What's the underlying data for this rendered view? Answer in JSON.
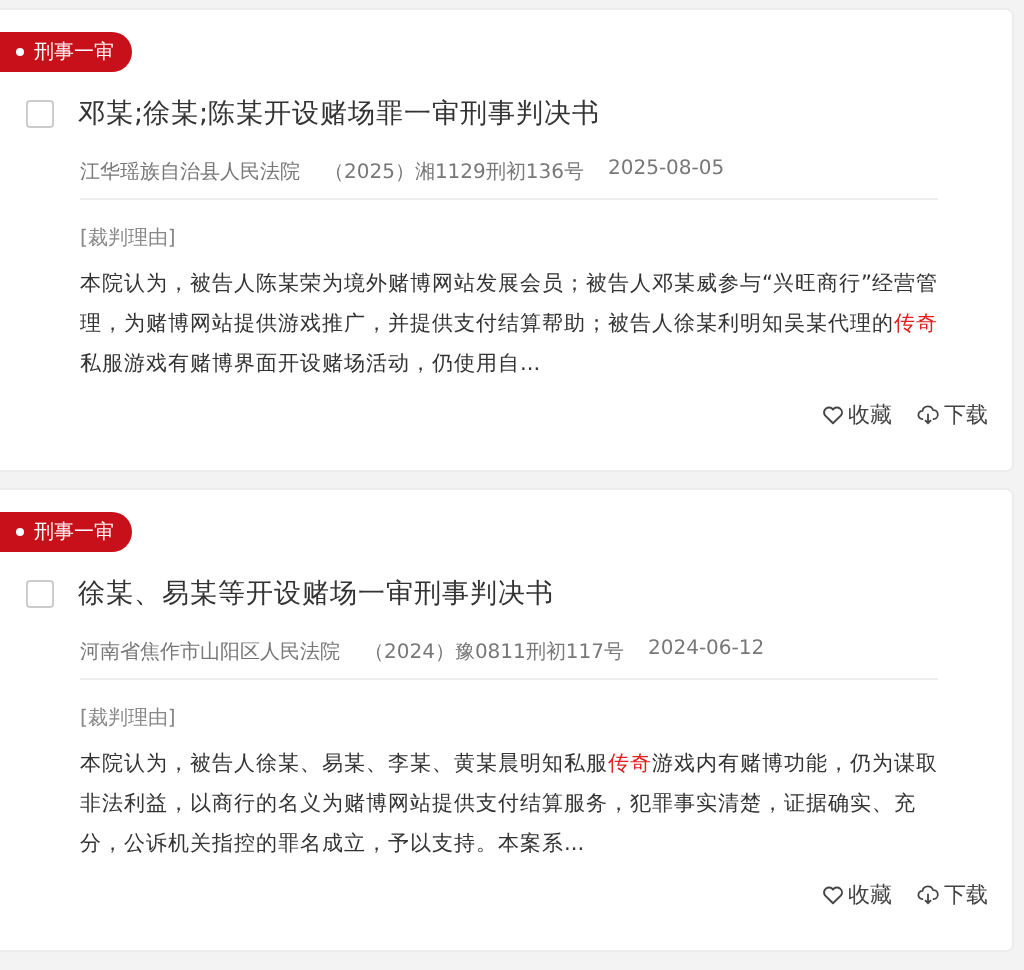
{
  "results": [
    {
      "tag": "刑事一审",
      "checked": false,
      "title": "邓某;徐某;陈某开设赌场罪一审刑事判决书",
      "court": "江华瑶族自治县人民法院",
      "case_number": "（2025）湘1129刑初136号",
      "date": "2025-08-05",
      "section_label": "[裁判理由]",
      "excerpt": [
        {
          "text": "本院认为，被告人陈某荣为境外赌博网站发展会员；被告人邓某威参与“兴旺商行”经营管理，为赌博网站提供游戏推广，并提供支付结算帮助；被告人徐某利明知吴某代理的",
          "highlight": false
        },
        {
          "text": "传奇",
          "highlight": true
        },
        {
          "text": "私服游戏有赌博界面开设赌场活动，仍使用自...",
          "highlight": false
        }
      ],
      "actions": [
        {
          "kind": "favorite",
          "label": "收藏"
        },
        {
          "kind": "download",
          "label": "下载"
        }
      ]
    },
    {
      "tag": "刑事一审",
      "checked": false,
      "title": "徐某、易某等开设赌场一审刑事判决书",
      "court": "河南省焦作市山阳区人民法院",
      "case_number": "（2024）豫0811刑初117号",
      "date": "2024-06-12",
      "section_label": "[裁判理由]",
      "excerpt": [
        {
          "text": "本院认为，被告人徐某、易某、李某、黄某晨明知私服",
          "highlight": false
        },
        {
          "text": "传奇",
          "highlight": true
        },
        {
          "text": "游戏内有赌博功能，仍为谋取非法利益，以商行的名义为赌博网站提供支付结算服务，犯罪事实清楚，证据确实、充分，公诉机关指控的罪名成立，予以支持。本案系...",
          "highlight": false
        }
      ],
      "actions": [
        {
          "kind": "favorite",
          "label": "收藏"
        },
        {
          "kind": "download",
          "label": "下载"
        }
      ]
    }
  ]
}
